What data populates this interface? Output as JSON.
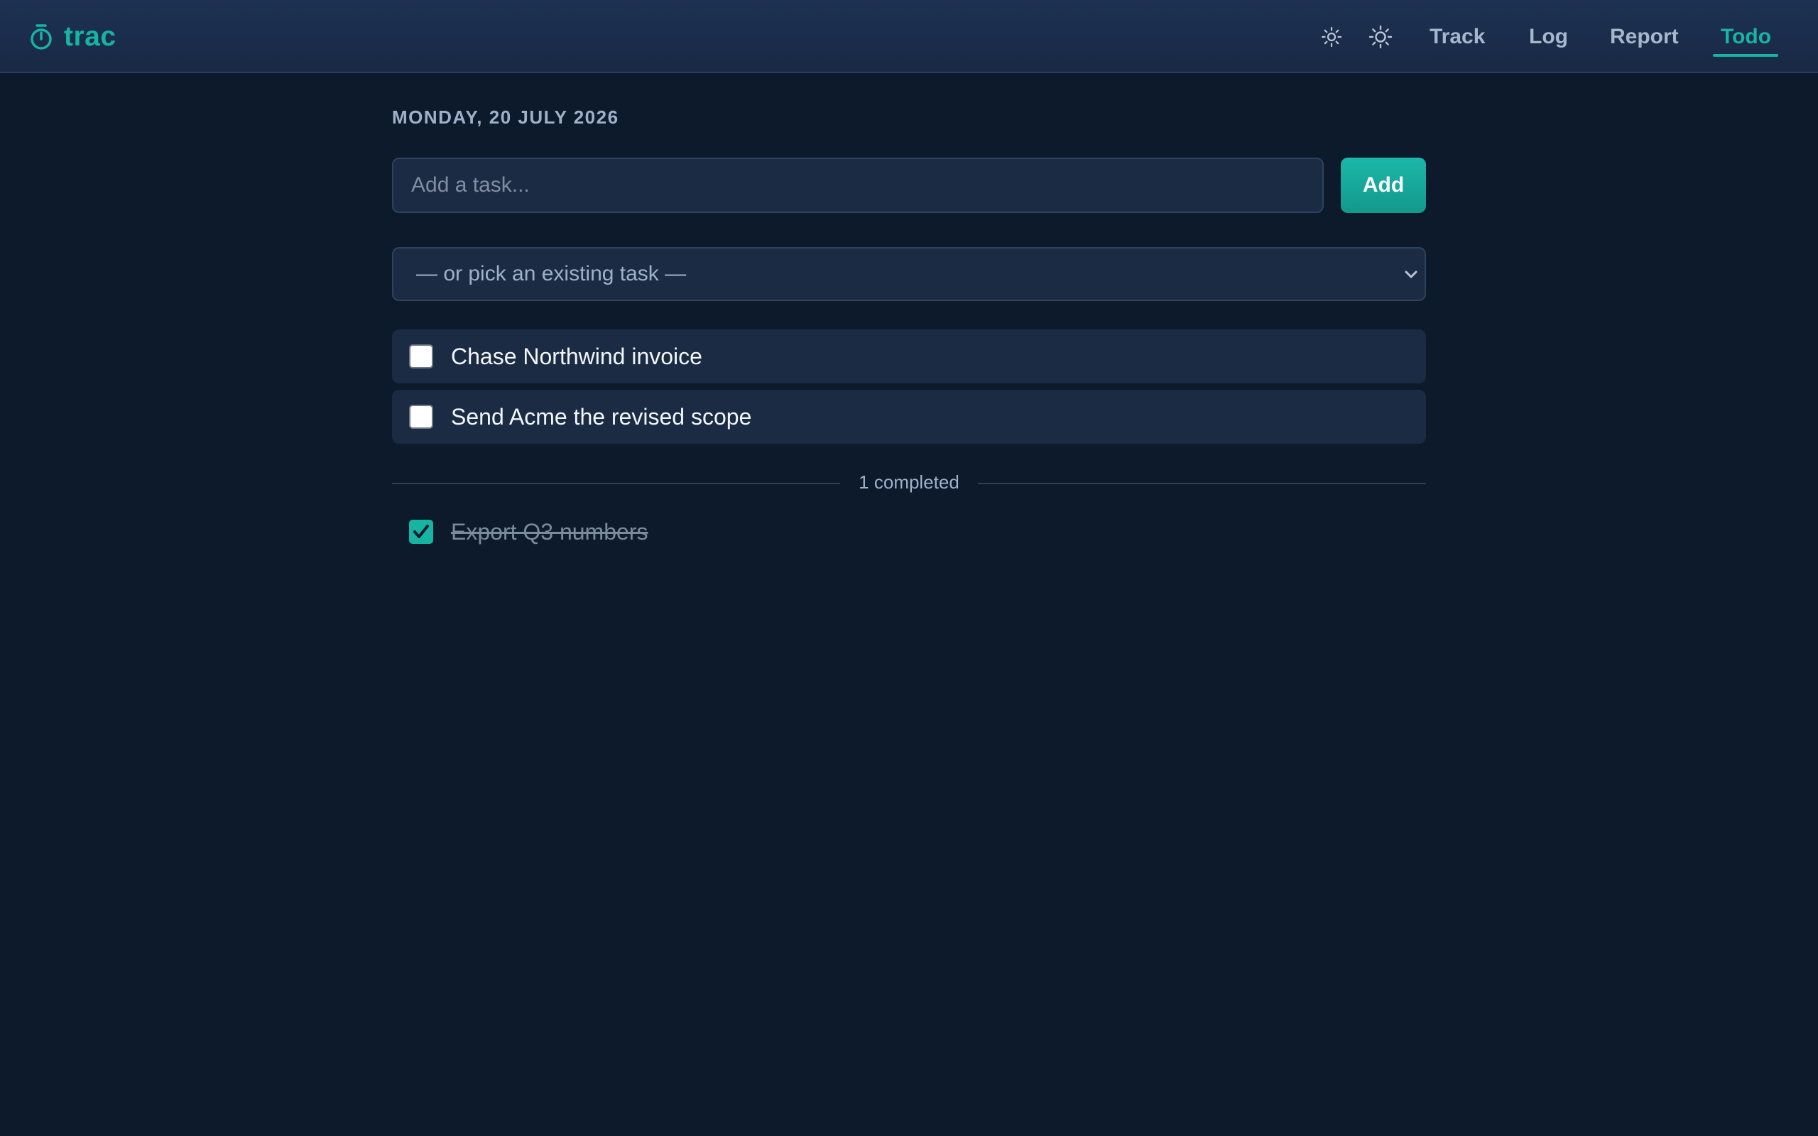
{
  "app": {
    "name": "trac",
    "brand_icon": "stopwatch-icon",
    "accent_color": "#17b3a3"
  },
  "header": {
    "theme_buttons": [
      {
        "icon": "sun-small-icon"
      },
      {
        "icon": "sun-icon"
      }
    ],
    "nav": [
      {
        "label": "Track",
        "active": false
      },
      {
        "label": "Log",
        "active": false
      },
      {
        "label": "Report",
        "active": false
      },
      {
        "label": "Todo",
        "active": true
      }
    ]
  },
  "main": {
    "date": "MONDAY, 20 JULY 2026",
    "new_task": {
      "placeholder": "Add a task...",
      "value": "",
      "add_label": "Add"
    },
    "pick_existing": {
      "selected": "— or pick an existing task —",
      "icon": "chevron-down-icon"
    },
    "todos": [
      {
        "text": "Chase Northwind invoice",
        "done": false
      },
      {
        "text": "Send Acme the revised scope",
        "done": false
      }
    ],
    "completed_label": "1 completed",
    "completed": [
      {
        "text": "Export Q3 numbers",
        "done": true
      }
    ]
  }
}
